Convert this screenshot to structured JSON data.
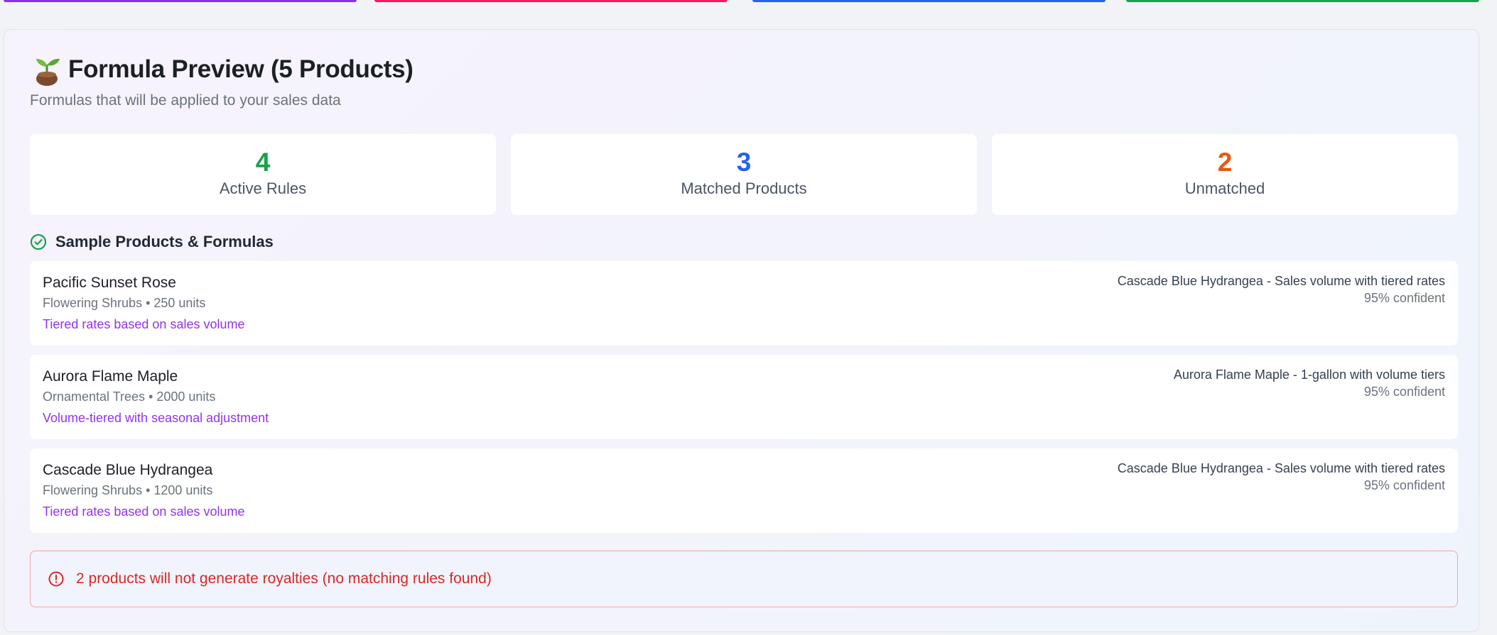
{
  "accents": {
    "strip_colors": [
      "#8b2cf5",
      "#ef1d5a",
      "#2563eb",
      "#16a34a"
    ],
    "active_color": "#16a34a",
    "matched_color": "#2563eb",
    "unmatched_color": "#ea580c",
    "formula_color": "#9333ea",
    "alert_color": "#dc2626"
  },
  "header": {
    "icon": "sprout-icon",
    "title": "Formula Preview (5 Products)",
    "subtitle": "Formulas that will be applied to your sales data"
  },
  "stats": [
    {
      "value": "4",
      "label": "Active Rules"
    },
    {
      "value": "3",
      "label": "Matched Products"
    },
    {
      "value": "2",
      "label": "Unmatched"
    }
  ],
  "section": {
    "icon": "check-circle-icon",
    "heading": "Sample Products & Formulas"
  },
  "products": [
    {
      "name": "Pacific Sunset Rose",
      "meta": "Flowering Shrubs • 250 units",
      "formula": "Tiered rates based on sales volume",
      "match": "Cascade Blue Hydrangea - Sales volume with tiered rates",
      "confidence": "95% confident"
    },
    {
      "name": "Aurora Flame Maple",
      "meta": "Ornamental Trees • 2000 units",
      "formula": "Volume-tiered with seasonal adjustment",
      "match": "Aurora Flame Maple - 1-gallon with volume tiers",
      "confidence": "95% confident"
    },
    {
      "name": "Cascade Blue Hydrangea",
      "meta": "Flowering Shrubs • 1200 units",
      "formula": "Tiered rates based on sales volume",
      "match": "Cascade Blue Hydrangea - Sales volume with tiered rates",
      "confidence": "95% confident"
    }
  ],
  "alert": {
    "icon": "alert-circle-icon",
    "text": "2 products will not generate royalties (no matching rules found)"
  }
}
